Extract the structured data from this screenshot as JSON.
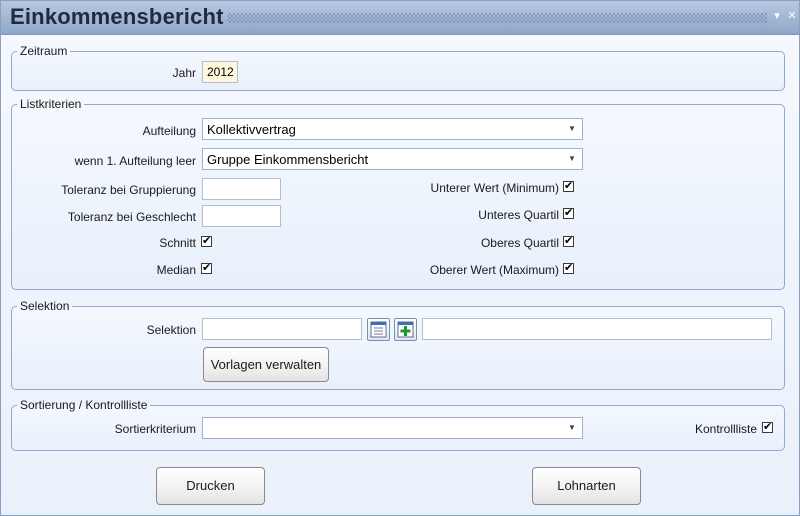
{
  "window": {
    "title": "Einkommensbericht",
    "minimize_icon": "minimize-icon",
    "close_icon": "close-icon",
    "minimize_glyph": "▾",
    "close_glyph": "✕"
  },
  "zeitraum": {
    "legend": "Zeitraum",
    "jahr_label": "Jahr",
    "jahr_value": "2012"
  },
  "listkriterien": {
    "legend": "Listkriterien",
    "aufteilung_label": "Aufteilung",
    "aufteilung_value": "Kollektivvertrag",
    "wenn_leer_label": "wenn 1. Aufteilung leer",
    "wenn_leer_value": "Gruppe Einkommensbericht",
    "toleranz_gruppierung_label": "Toleranz bei Gruppierung",
    "toleranz_gruppierung_value": "",
    "toleranz_geschlecht_label": "Toleranz bei Geschlecht",
    "toleranz_geschlecht_value": "",
    "schnitt_label": "Schnitt",
    "median_label": "Median",
    "unterer_wert_label": "Unterer Wert (Minimum)",
    "unteres_quartil_label": "Unteres Quartil",
    "oberes_quartil_label": "Oberes Quartil",
    "oberer_wert_label": "Oberer Wert (Maximum)",
    "check_glyph": "✔"
  },
  "selektion": {
    "legend": "Selektion",
    "selektion_label": "Selektion",
    "selektion_value": "",
    "selektion_text_value": "",
    "vorlagen_button": "Vorlagen verwalten",
    "list_icon": "list-icon",
    "add_icon": "add-icon"
  },
  "sortierung": {
    "legend": "Sortierung / Kontrollliste",
    "sortierkriterium_label": "Sortierkriterium",
    "sortierkriterium_value": "",
    "kontrollliste_label": "Kontrollliste"
  },
  "actions": {
    "drucken": "Drucken",
    "lohnarten": "Lohnarten"
  },
  "dropdown_glyph": "▼"
}
